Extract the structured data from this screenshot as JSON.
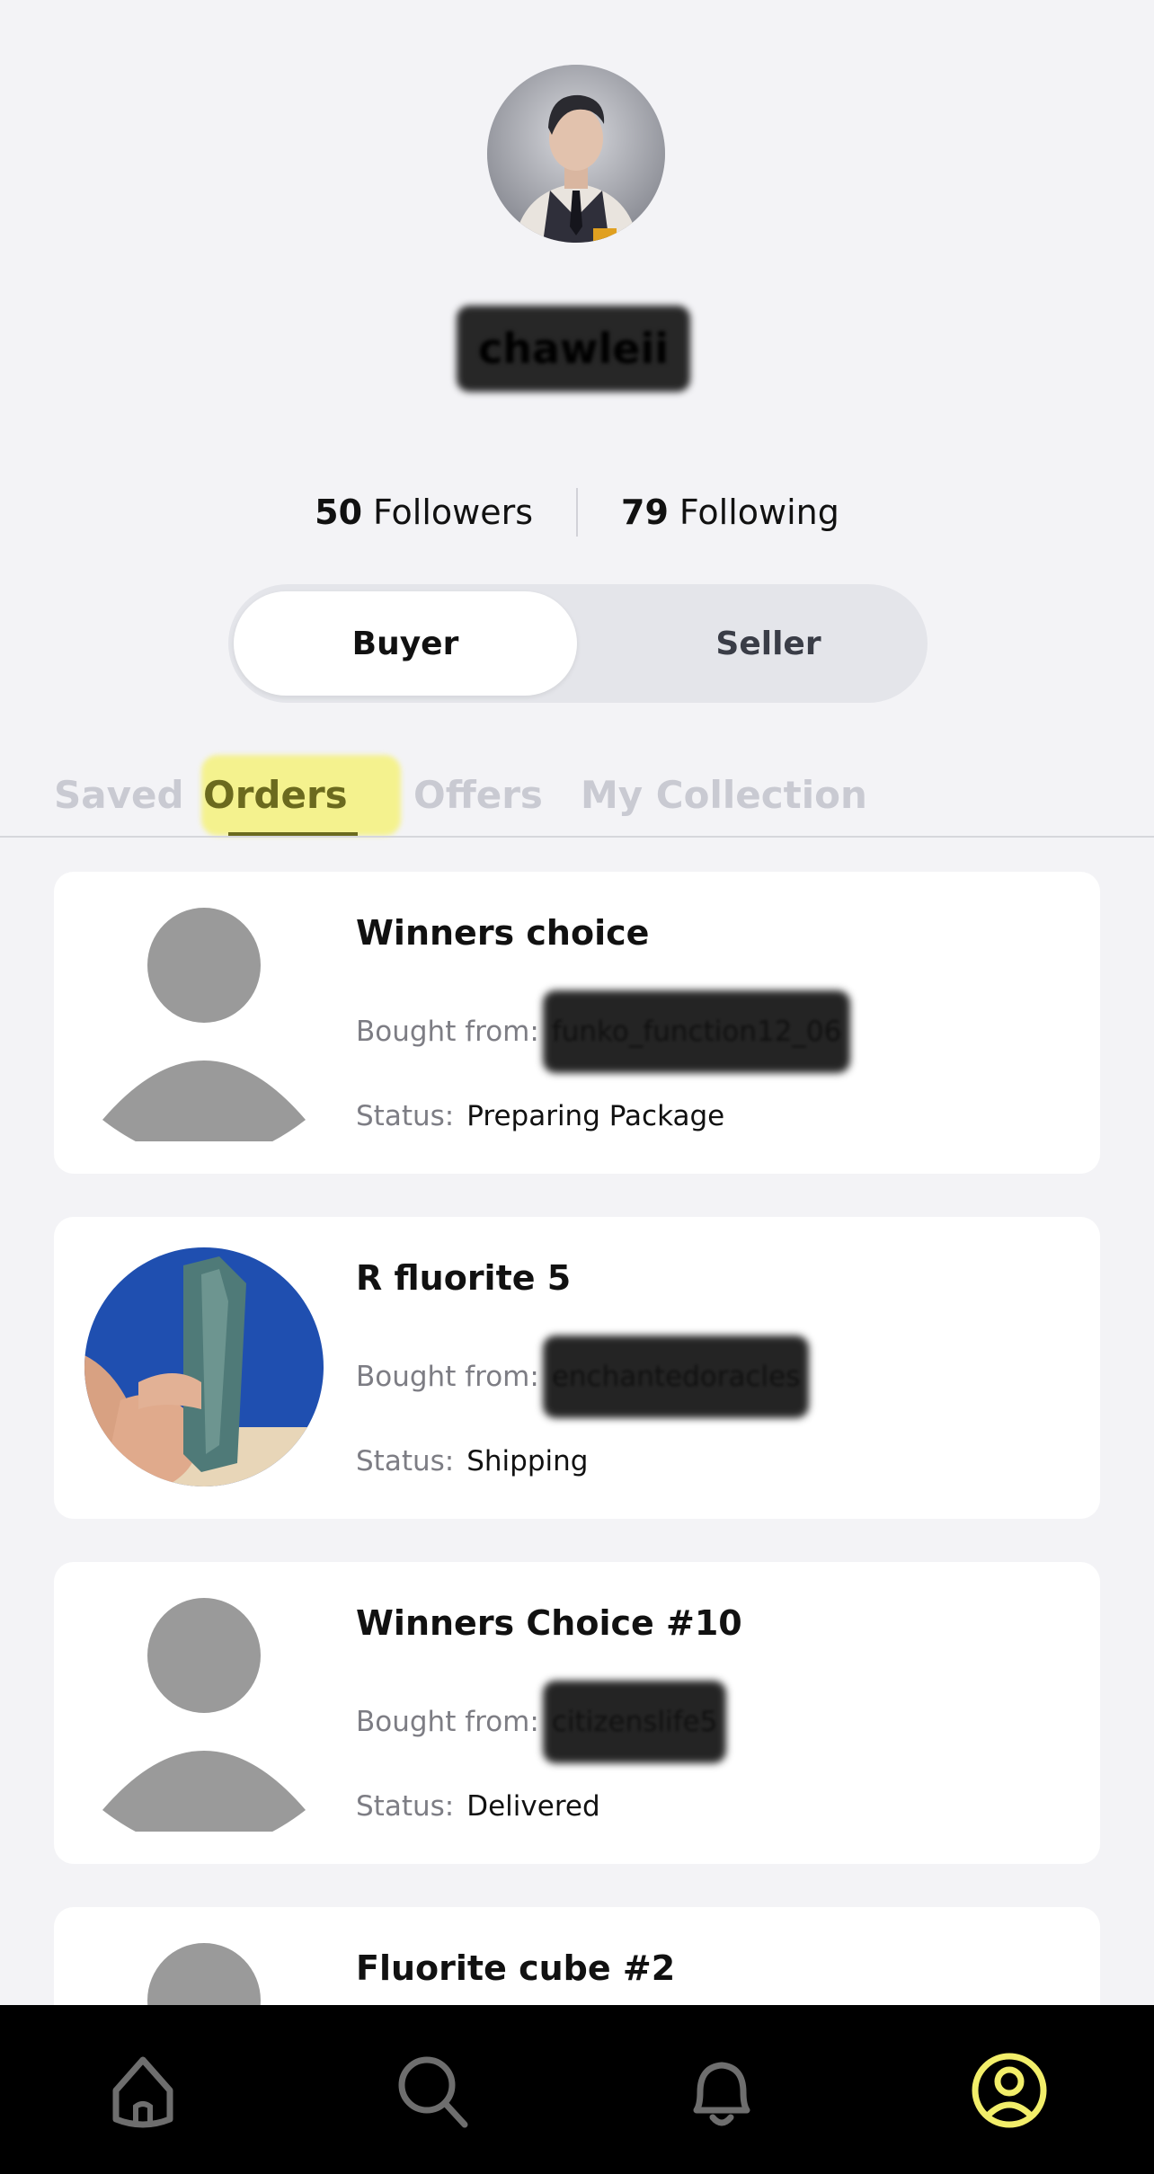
{
  "profile": {
    "username": "chawleii",
    "followers_count": "50",
    "followers_label": "Followers",
    "following_count": "79",
    "following_label": "Following"
  },
  "role_toggle": {
    "buyer_label": "Buyer",
    "seller_label": "Seller",
    "selected": "Buyer"
  },
  "tabs": [
    {
      "label": "Saved"
    },
    {
      "label": "Orders"
    },
    {
      "label": "Offers"
    },
    {
      "label": "My Collection"
    }
  ],
  "active_tab": "Orders",
  "order_labels": {
    "bought_from": "Bought from:",
    "status": "Status:"
  },
  "orders": [
    {
      "title": "Winners choice",
      "seller": "funko_function12_06",
      "status": "Preparing Package"
    },
    {
      "title": "R fluorite 5",
      "seller": "enchantedoracles",
      "status": "Shipping"
    },
    {
      "title": "Winners Choice #10",
      "seller": "citizenslife5",
      "status": "Delivered"
    },
    {
      "title": "Fluorite cube #2"
    }
  ],
  "nav": {
    "items": [
      "home-icon",
      "search-icon",
      "bell-icon",
      "profile-icon"
    ],
    "active": "profile-icon"
  },
  "colors": {
    "accent": "#f5f27c",
    "tab_active": "#6b6a1e",
    "nav_bg": "#000000",
    "nav_active": "#f2ee6a",
    "nav_inactive": "#6e6e6e"
  }
}
